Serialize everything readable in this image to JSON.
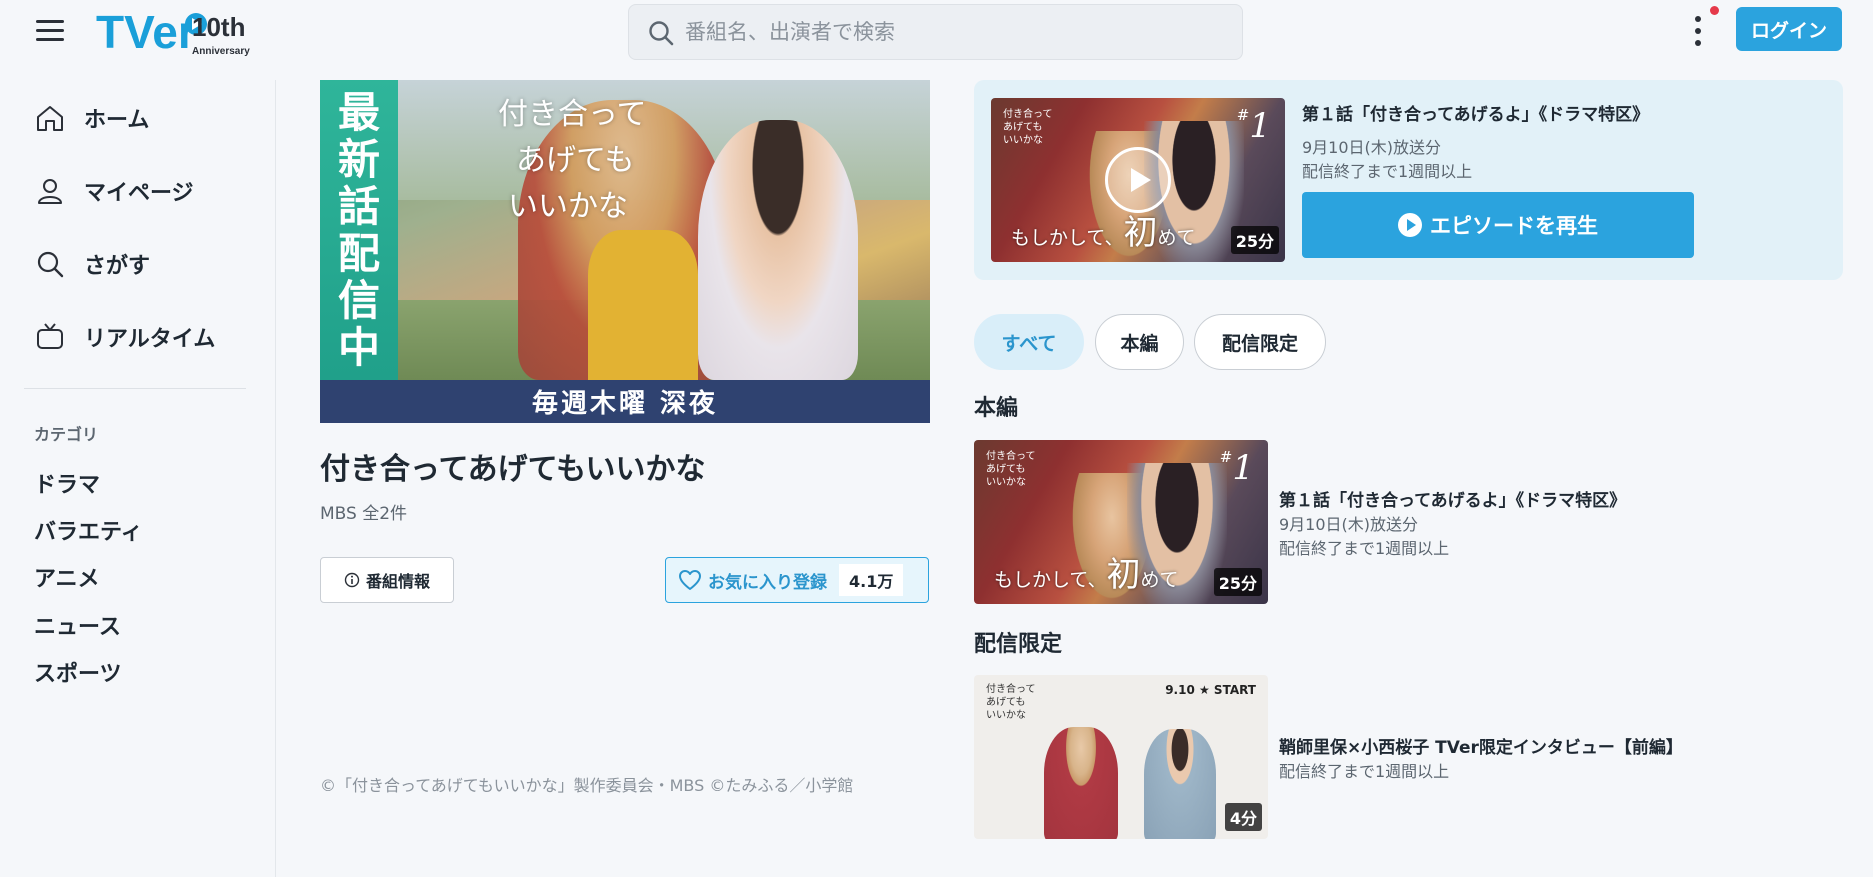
{
  "header": {
    "logo_text": "TVer",
    "logo_badge": "10th",
    "logo_badge_sub": "Anniversary",
    "search_placeholder": "番組名、出演者で検索",
    "login_label": "ログイン"
  },
  "sidebar": {
    "nav": [
      {
        "label": "ホーム",
        "icon": "home-icon"
      },
      {
        "label": "マイページ",
        "icon": "user-icon"
      },
      {
        "label": "さがす",
        "icon": "search-icon"
      },
      {
        "label": "リアルタイム",
        "icon": "tv-icon"
      }
    ],
    "category_heading": "カテゴリ",
    "categories": [
      "ドラマ",
      "バラエティ",
      "アニメ",
      "ニュース",
      "スポーツ"
    ]
  },
  "hero": {
    "side_text": [
      "最",
      "新",
      "話",
      "配",
      "信",
      "中"
    ],
    "title_art": [
      "付き合って",
      "あげても",
      "いいかな"
    ],
    "band_text": "毎週木曜 深夜"
  },
  "show": {
    "title": "付き合ってあげてもいいかな",
    "meta": "MBS 全2件",
    "info_label": "番組情報",
    "fav_label": "お気に入り登録",
    "fav_count": "4.1万",
    "copyright": "©「付き合ってあげてもいいかな」製作委員会・MBS ©たみふる／小学館"
  },
  "featured": {
    "thumb_title": [
      "付き合って",
      "あげても",
      "いいかな"
    ],
    "ep_mark": "#",
    "ep_number": "1",
    "caption_pre": "もしかして、",
    "caption_big": "初",
    "caption_post": "めて",
    "duration": "25分",
    "title": "第１話「付き合ってあげるよ」《ドラマ特区》",
    "date": "9月10日(木)放送分",
    "availability": "配信終了まで1週間以上",
    "play_label": "エピソードを再生"
  },
  "filters": [
    "すべて",
    "本編",
    "配信限定"
  ],
  "sections": {
    "main": {
      "heading": "本編",
      "episode": {
        "title": "第１話「付き合ってあげるよ」《ドラマ特区》",
        "date": "9月10日(木)放送分",
        "availability": "配信終了まで1週間以上",
        "duration": "25分"
      }
    },
    "limited": {
      "heading": "配信限定",
      "episode": {
        "thumb_title": [
          "付き合って",
          "あげても",
          "いいかな"
        ],
        "start_label": "9.10 ★ START",
        "title": "鞘師里保×小西桜子 TVer限定インタビュー【前編】",
        "availability": "配信終了まで1週間以上",
        "duration": "4分"
      }
    }
  },
  "colors": {
    "accent": "#2ba3de",
    "background": "#f5f7fa",
    "hero_side": "#20a08a",
    "hero_band": "#2f4270",
    "notification": "#e5394a"
  }
}
